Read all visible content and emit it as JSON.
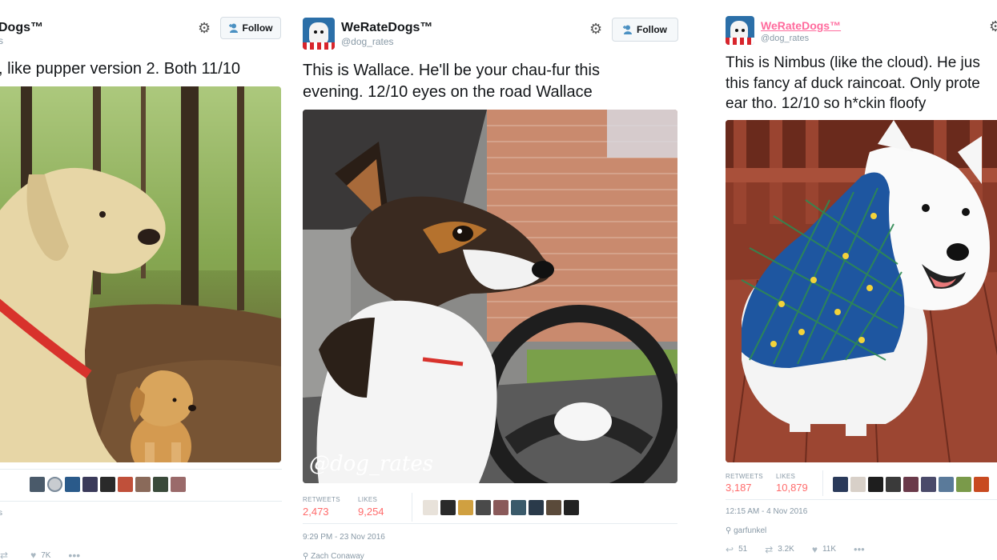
{
  "tweets": [
    {
      "name": "Dogs™",
      "handle": "s",
      "follow_label": "Follow",
      "text_lines": [
        ", like pupper version 2. Both 11/10"
      ],
      "stats_line": "s",
      "actions": {
        "retweets": "",
        "likes": "7K"
      }
    },
    {
      "name": "WeRateDogs™",
      "handle": "@dog_rates",
      "follow_label": "Follow",
      "text_lines": [
        "This is Wallace. He'll be your chau-fur this",
        "evening. 12/10 eyes on the road Wallace"
      ],
      "watermark": "@dog_rates",
      "retweets_label": "RETWEETS",
      "retweets": "2,473",
      "likes_label": "LIKES",
      "likes": "9,254",
      "timestamp": "9:29 PM - 23 Nov 2016",
      "location": "Zach Conaway"
    },
    {
      "name": "WeRateDogs™",
      "handle": "@dog_rates",
      "text_lines": [
        "This is Nimbus (like the cloud). He jus",
        "this fancy af duck raincoat. Only prote",
        "ear tho. 12/10 so h*ckin floofy"
      ],
      "retweets_label": "RETWEETS",
      "retweets": "3,187",
      "likes_label": "LIKES",
      "likes": "10,879",
      "timestamp": "12:15 AM - 4 Nov 2016",
      "place": "garfunkel",
      "actions": {
        "replies": "51",
        "retweets": "3.2K",
        "likes": "11K"
      }
    }
  ],
  "colors": {
    "stat_red": "#ff6b6b",
    "handle_gray": "#8899a6",
    "name_pink": "#ff6b9d"
  }
}
